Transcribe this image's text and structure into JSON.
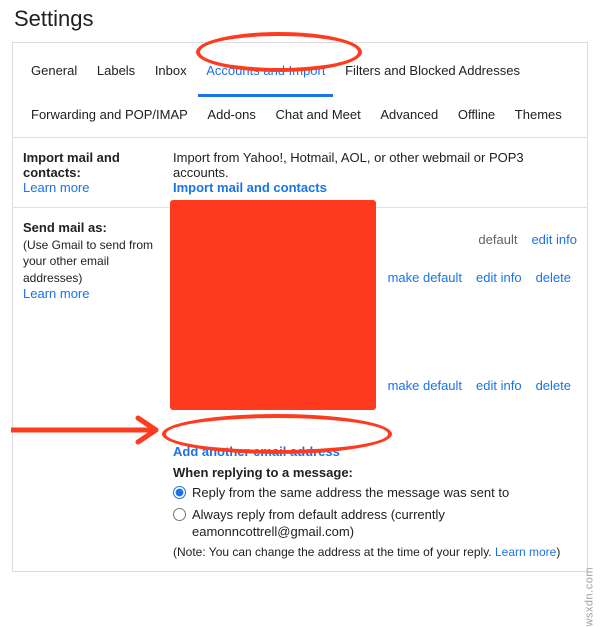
{
  "page_title": "Settings",
  "tabs": {
    "general": "General",
    "labels": "Labels",
    "inbox": "Inbox",
    "accounts": "Accounts and Import",
    "filters": "Filters and Blocked Addresses",
    "forwarding": "Forwarding and POP/IMAP",
    "addons": "Add-ons",
    "chat": "Chat and Meet",
    "advanced": "Advanced",
    "offline": "Offline",
    "themes": "Themes"
  },
  "import_section": {
    "title": "Import mail and contacts:",
    "learn_more": "Learn more",
    "desc": "Import from Yahoo!, Hotmail, AOL, or other webmail or POP3 accounts.",
    "action": "Import mail and contacts"
  },
  "sendas_section": {
    "title": "Send mail as:",
    "sub": "(Use Gmail to send from your other email addresses)",
    "learn_more": "Learn more",
    "row1": {
      "default_label": "default",
      "edit": "edit info"
    },
    "row2": {
      "make_default": "make default",
      "edit": "edit info",
      "delete": "delete"
    },
    "row3": {
      "make_default": "make default",
      "edit": "edit info",
      "delete": "delete"
    },
    "add_another": "Add another email address",
    "reply_title": "When replying to a message:",
    "reply_opt1": "Reply from the same address the message was sent to",
    "reply_opt2_a": "Always reply from default address (currently ",
    "reply_opt2_b": "eamonncottrell@gmail.com",
    "reply_opt2_c": ")",
    "note_a": "(Note: You can change the address at the time of your reply. ",
    "note_link": "Learn more",
    "note_b": ")"
  },
  "watermark": "wsxdn.com"
}
